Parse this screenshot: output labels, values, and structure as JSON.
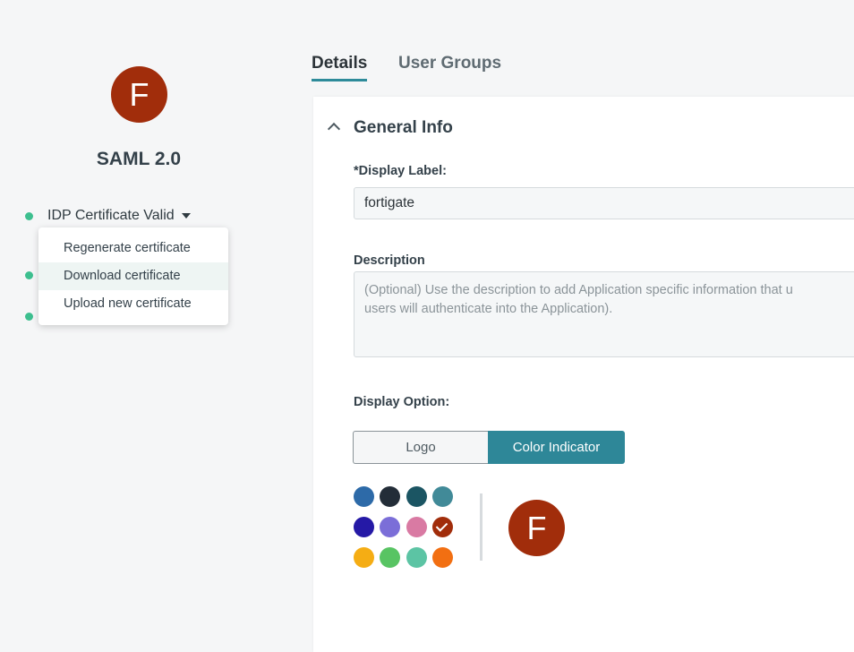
{
  "app": {
    "avatar_letter": "F",
    "avatar_color": "#a12d0b",
    "type": "SAML 2.0",
    "status_color": "#3dbf8f"
  },
  "certificate": {
    "status": "IDP Certificate Valid",
    "menu": [
      "Regenerate certificate",
      "Download certificate",
      "Upload new certificate"
    ],
    "highlighted_item": "Download certificate"
  },
  "tabs": [
    {
      "label": "Details",
      "active": true
    },
    {
      "label": "User Groups",
      "active": false
    }
  ],
  "general_info": {
    "title": "General Info",
    "display_label": {
      "label": "*Display Label:",
      "value": "fortigate"
    },
    "description": {
      "label": "Description",
      "placeholder": "(Optional) Use the description to add Application specific information that u\nusers will authenticate into the Application)."
    },
    "display_option": {
      "label": "Display Option:",
      "options": [
        "Logo",
        "Color Indicator"
      ],
      "selected": "Color Indicator"
    },
    "palette": [
      "#2d6aa8",
      "#232d38",
      "#1b5563",
      "#418a98",
      "#2519a6",
      "#7b6ed8",
      "#d97aa3",
      "#a12d0b",
      "#f5ad14",
      "#58c463",
      "#5cc4a4",
      "#f26f12"
    ],
    "selected_color": "#a12d0b",
    "preview_letter": "F"
  }
}
